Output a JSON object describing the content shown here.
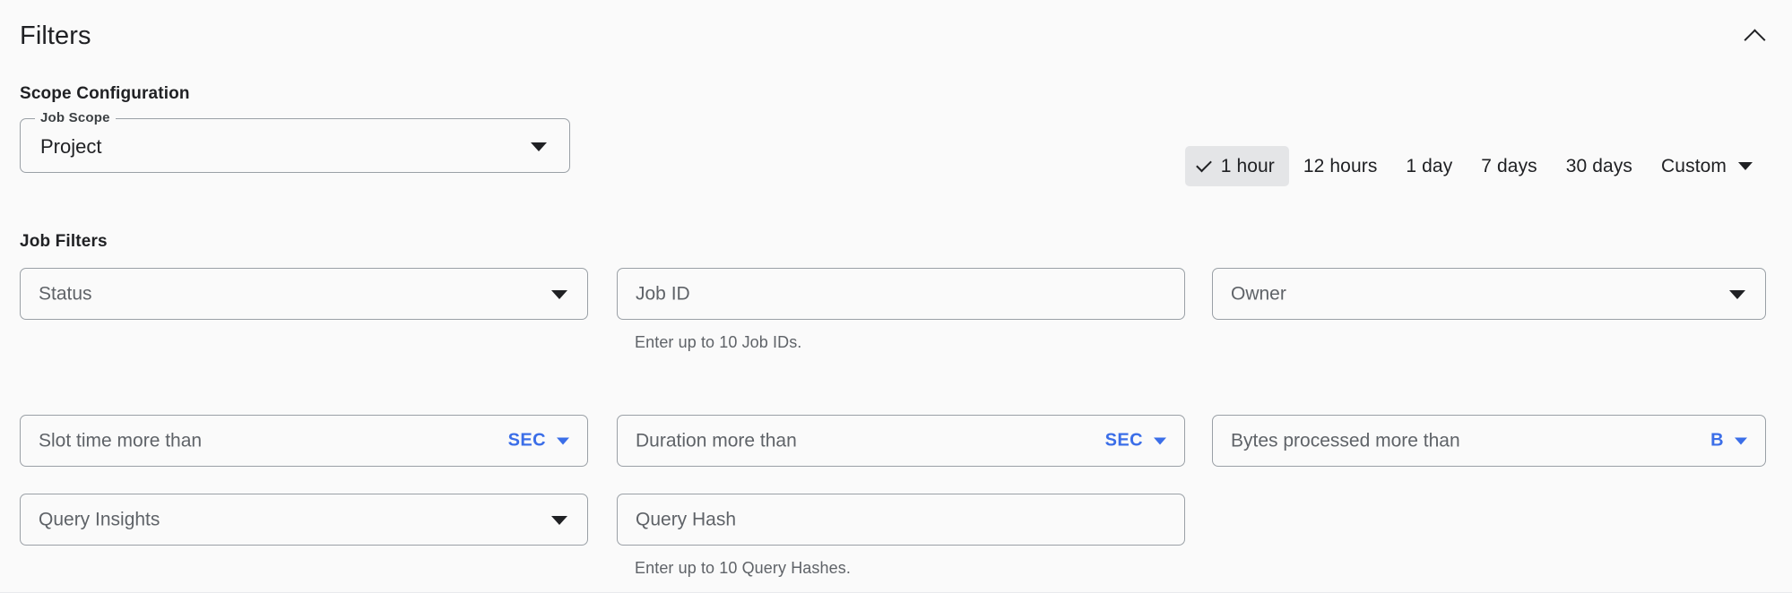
{
  "header": {
    "title": "Filters",
    "collapse_icon": "chevron-up-icon"
  },
  "scope_section": {
    "heading": "Scope Configuration",
    "job_scope": {
      "label": "Job Scope",
      "value": "Project",
      "caret_icon": "caret-down-icon"
    }
  },
  "time_range": {
    "selected": "1 hour",
    "check_icon": "check-icon",
    "options": [
      {
        "label": "1 hour",
        "selected": true
      },
      {
        "label": "12 hours",
        "selected": false
      },
      {
        "label": "1 day",
        "selected": false
      },
      {
        "label": "7 days",
        "selected": false
      },
      {
        "label": "30 days",
        "selected": false
      }
    ],
    "custom": {
      "label": "Custom",
      "caret_icon": "caret-down-icon"
    }
  },
  "job_filters": {
    "heading": "Job Filters",
    "fields": {
      "status": {
        "placeholder": "Status",
        "value": "",
        "caret_icon": "caret-down-icon"
      },
      "job_id": {
        "placeholder": "Job ID",
        "value": "",
        "helper": "Enter up to 10 Job IDs."
      },
      "owner": {
        "placeholder": "Owner",
        "value": "",
        "caret_icon": "caret-down-icon"
      },
      "slot_time": {
        "placeholder": "Slot time more than",
        "value": "",
        "unit": "SEC",
        "unit_caret_icon": "caret-down-icon"
      },
      "duration": {
        "placeholder": "Duration more than",
        "value": "",
        "unit": "SEC",
        "unit_caret_icon": "caret-down-icon"
      },
      "bytes_processed": {
        "placeholder": "Bytes processed more than",
        "value": "",
        "unit": "B",
        "unit_caret_icon": "caret-down-icon"
      },
      "query_insights": {
        "placeholder": "Query Insights",
        "value": "",
        "caret_icon": "caret-down-icon"
      },
      "query_hash": {
        "placeholder": "Query Hash",
        "value": "",
        "helper": "Enter up to 10 Query Hashes."
      }
    }
  },
  "colors": {
    "background": "#fafafa",
    "text_primary": "#202124",
    "text_secondary": "#5f6368",
    "border": "#9aa0a6",
    "accent_blue": "#3b6ee8",
    "selected_chip_bg": "#e4e5e7"
  }
}
